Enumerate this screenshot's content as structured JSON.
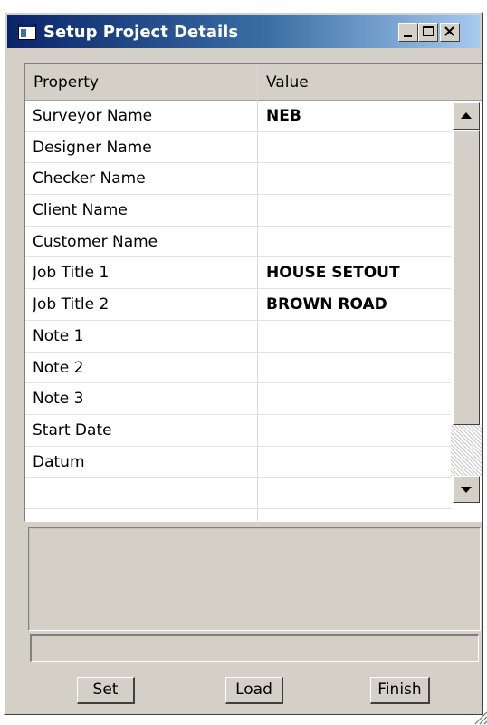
{
  "window": {
    "title": "Setup Project Details"
  },
  "grid": {
    "columns": {
      "property": "Property",
      "value": "Value"
    },
    "rows": [
      {
        "property": "Surveyor Name",
        "value": "NEB"
      },
      {
        "property": "Designer Name",
        "value": ""
      },
      {
        "property": "Checker Name",
        "value": ""
      },
      {
        "property": "Client Name",
        "value": ""
      },
      {
        "property": "Customer Name",
        "value": ""
      },
      {
        "property": "Job Title 1",
        "value": "HOUSE SETOUT"
      },
      {
        "property": "Job Title 2",
        "value": "BROWN ROAD"
      },
      {
        "property": "Note 1",
        "value": ""
      },
      {
        "property": "Note 2",
        "value": ""
      },
      {
        "property": "Note 3",
        "value": ""
      },
      {
        "property": "Start Date",
        "value": ""
      },
      {
        "property": "Datum",
        "value": ""
      },
      {
        "property": "",
        "value": ""
      }
    ]
  },
  "buttons": {
    "set": "Set",
    "load": "Load",
    "finish": "Finish"
  },
  "icons": {
    "app": "window-app-icon",
    "minimize": "minimize-icon",
    "maximize": "maximize-icon",
    "close": "close-icon"
  },
  "colors": {
    "titlebar_start": "#0a246a",
    "titlebar_end": "#a6caf0",
    "face": "#d4d0c8"
  }
}
